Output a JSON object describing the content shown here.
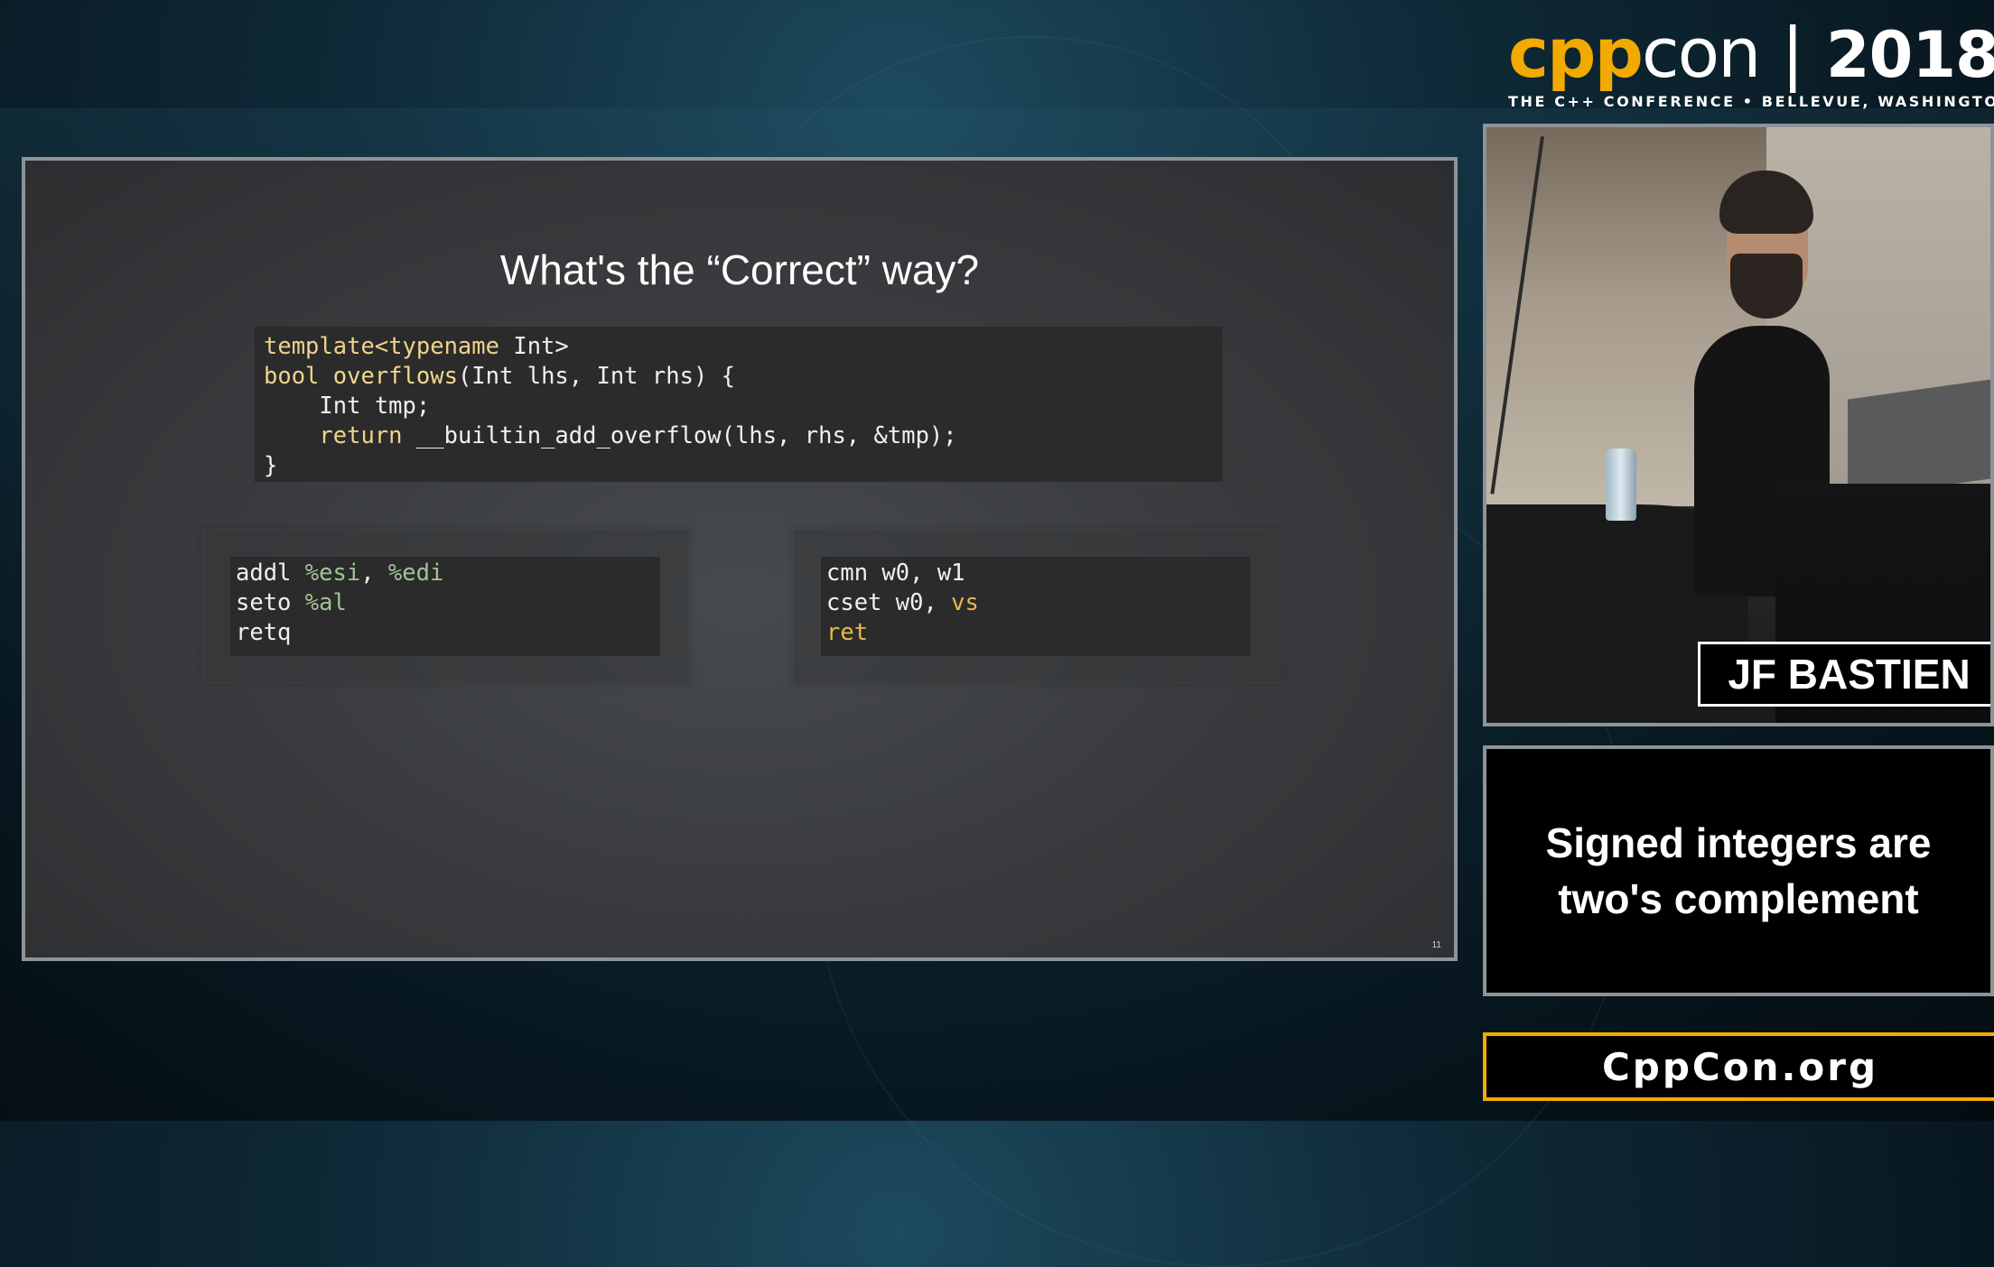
{
  "brand": {
    "logo_cpp": "cpp",
    "logo_con": "con",
    "logo_year": "2018",
    "tagline": "THE C++ CONFERENCE • BELLEVUE, WASHINGTON"
  },
  "slide": {
    "title": "What's the “Correct” way?",
    "code_main": {
      "line1_kw": "template<typename",
      "line1_rest": " Int>",
      "line2_kw": "bool",
      "line2_fn": " overflows",
      "line2_rest": "(Int lhs, Int rhs) {",
      "line3": "    Int tmp;",
      "line4_kw": "    return",
      "line4_rest": " __builtin_add_overflow(lhs, rhs, &tmp);",
      "line5": "}"
    },
    "asm_x86": {
      "l1_op": "addl ",
      "l1_reg1": "%esi",
      "l1_sep": ", ",
      "l1_reg2": "%edi",
      "l2_op": "seto ",
      "l2_reg": "%al",
      "l3_op": "retq"
    },
    "asm_arm": {
      "l1": "cmn w0, w1",
      "l2_op": "cset w0, ",
      "l2_cond": "vs",
      "l3": "ret"
    },
    "page_number": "11"
  },
  "speaker": {
    "name": "JF BASTIEN"
  },
  "caption": {
    "line1": "Signed integers are",
    "line2": "two's complement"
  },
  "website": "CppCon.org",
  "colors": {
    "brand_orange": "#f2a900",
    "code_keyword": "#f0d28c",
    "code_register": "#9fc494",
    "code_condition": "#e8b84a",
    "slide_bg": "#3a3c3f",
    "code_bg": "#2b2b2b"
  }
}
